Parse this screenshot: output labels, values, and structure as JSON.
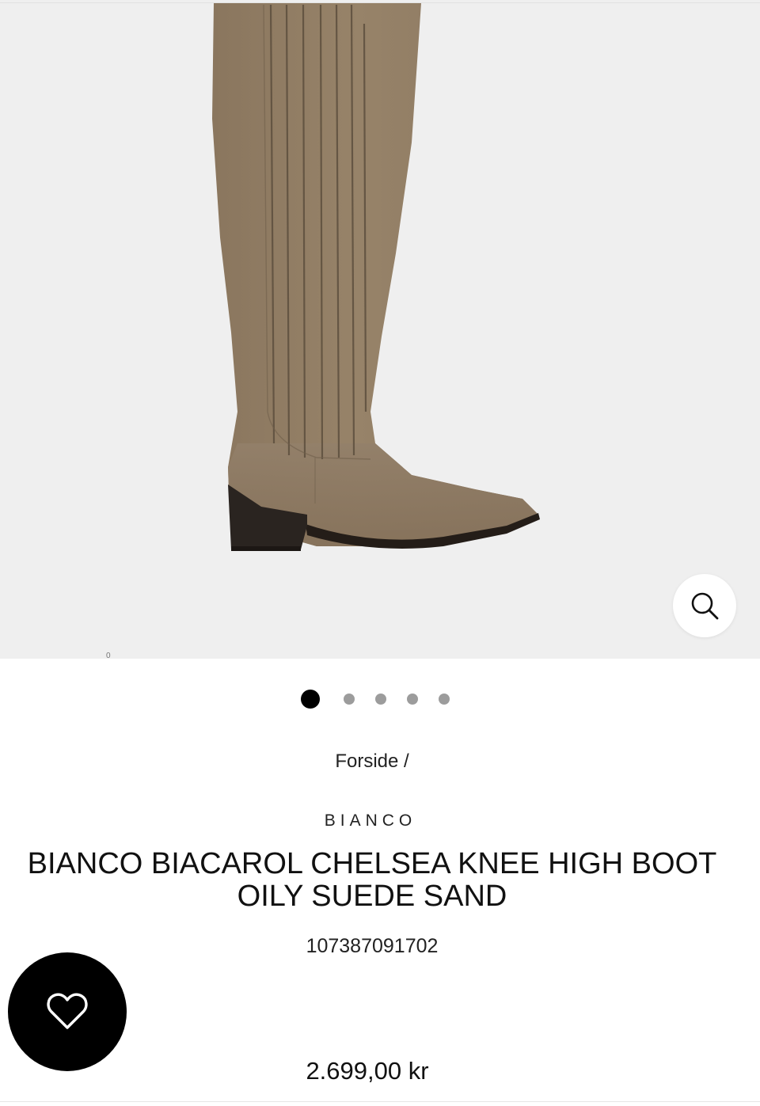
{
  "product_image": {
    "alt": "",
    "small_mark": "0"
  },
  "zoom": {
    "icon": "search-icon"
  },
  "carousel": {
    "total": 5,
    "active_index": 0
  },
  "breadcrumb": {
    "home_label": "Forside",
    "separator": " /"
  },
  "product": {
    "brand": "BIANCO",
    "title": "BIANCO BIACAROL CHELSEA KNEE HIGH BOOT OILY SUEDE SAND",
    "sku": "107387091702",
    "price": "2.699,00 kr"
  },
  "wishlist": {
    "icon": "heart-icon"
  },
  "colors": {
    "image_background": "#efefef",
    "suede": "#8f7b63",
    "heel": "#2a2420",
    "accent": "#000000"
  }
}
